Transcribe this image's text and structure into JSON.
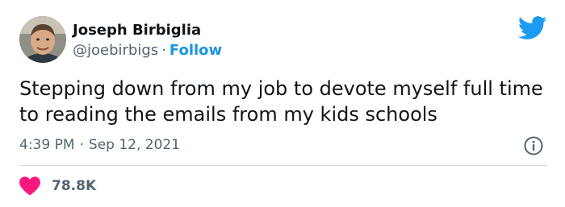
{
  "author": {
    "name": "Joseph Birbiglia",
    "handle": "@joebirbigs",
    "separator": "·",
    "follow_label": "Follow"
  },
  "tweet": {
    "text": "Stepping down from my job to devote myself full time to reading the emails from my kids schools",
    "time": "4:39 PM",
    "separator": "·",
    "date": "Sep 12, 2021",
    "like_count": "78.8K"
  },
  "icons": {
    "brand": "twitter-bird-icon",
    "info": "info-icon",
    "like": "heart-icon"
  },
  "colors": {
    "brand": "#1d9bf0",
    "follow": "#1b95e0",
    "like": "#f91880",
    "secondary_text": "#536471"
  }
}
